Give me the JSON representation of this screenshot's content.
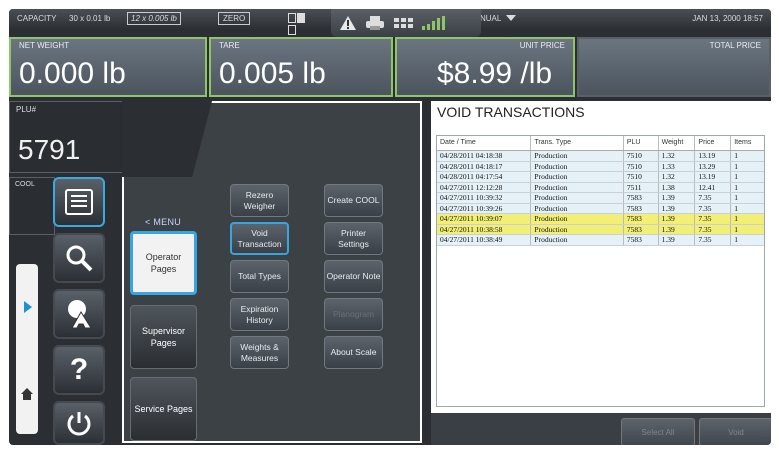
{
  "status_bar": {
    "capacity_label": "CAPACITY",
    "capacity_value_1": "30 x 0.01 lb",
    "capacity_value_2": "12 x 0.005 lb",
    "zero_label": "ZERO",
    "mode_label": "MANUAL",
    "datetime": "JAN 13, 2000 18:57"
  },
  "weights": {
    "net_weight_label": "NET WEIGHT",
    "net_weight_value": "0.000 lb",
    "tare_label": "TARE",
    "tare_value": "0.005 lb",
    "unit_price_label": "UNIT PRICE",
    "unit_price_value": "$8.99 /lb",
    "total_price_label": "TOTAL PRICE"
  },
  "plu": {
    "label": "PLU#",
    "value": "5791"
  },
  "cool": {
    "label": "COOL"
  },
  "menu": {
    "back_label": "< MENU",
    "pages": [
      {
        "label": "Operator Pages",
        "selected": true
      },
      {
        "label": "Supervisor Pages",
        "selected": false
      },
      {
        "label": "Service Pages",
        "selected": false
      }
    ],
    "functions": [
      {
        "label": "Rezero Weigher"
      },
      {
        "label": "Create COOL"
      },
      {
        "label": "Void Transaction"
      },
      {
        "label": "Printer Settings"
      },
      {
        "label": "Total Types"
      },
      {
        "label": "Operator Note"
      },
      {
        "label": "Expiration History"
      },
      {
        "label": "Planogram"
      },
      {
        "label": "Weights & Measures"
      },
      {
        "label": "About Scale"
      }
    ]
  },
  "void_panel": {
    "title": "VOID TRANSACTIONS",
    "columns": [
      "Date / Time",
      "Trans. Type",
      "PLU",
      "Weight",
      "Price",
      "Items"
    ],
    "rows": [
      {
        "cells": [
          "04/28/2011 04:18:38",
          "Production",
          "7510",
          "1.32",
          "13.19",
          "1"
        ],
        "highlight": false
      },
      {
        "cells": [
          "04/28/2011 04:18:17",
          "Production",
          "7510",
          "1.33",
          "13.29",
          "1"
        ],
        "highlight": false
      },
      {
        "cells": [
          "04/28/2011 04:17:54",
          "Production",
          "7510",
          "1.32",
          "13.19",
          "1"
        ],
        "highlight": false
      },
      {
        "cells": [
          "04/27/2011 12:12:28",
          "Production",
          "7511",
          "1.38",
          "12.41",
          "1"
        ],
        "highlight": false
      },
      {
        "cells": [
          "04/27/2011 10:39:32",
          "Production",
          "7583",
          "1.39",
          "7.35",
          "1"
        ],
        "highlight": false
      },
      {
        "cells": [
          "04/27/2011 10:39:26",
          "Production",
          "7583",
          "1.39",
          "7.35",
          "1"
        ],
        "highlight": false
      },
      {
        "cells": [
          "04/27/2011 10:39:07",
          "Production",
          "7583",
          "1.39",
          "7.35",
          "1"
        ],
        "highlight": true
      },
      {
        "cells": [
          "04/27/2011 10:38:58",
          "Production",
          "7583",
          "1.39",
          "7.35",
          "1"
        ],
        "highlight": true
      },
      {
        "cells": [
          "04/27/2011 10:38:49",
          "Production",
          "7583",
          "1.39",
          "7.35",
          "1"
        ],
        "highlight": false
      }
    ],
    "select_all_label": "Select All",
    "void_label": "Void"
  },
  "colors": {
    "accent": "#36a6e0",
    "weight_border": "#8fc46a",
    "highlight_row": "#f3ee76"
  }
}
